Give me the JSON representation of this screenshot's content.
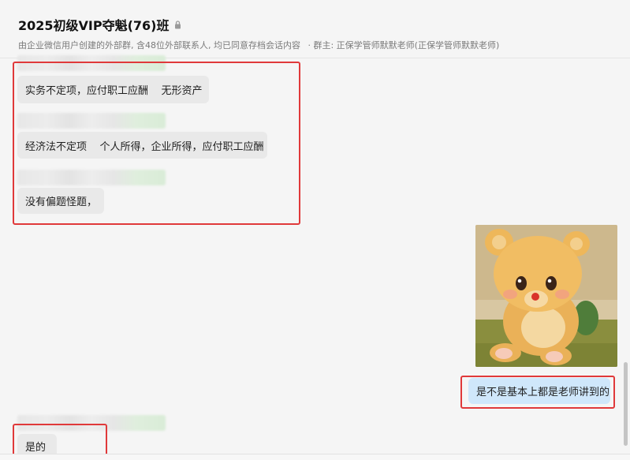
{
  "header": {
    "group_name": "2025初级VIP夺魁(76)班",
    "subtitle": "由企业微信用户创建的外部群, 含48位外部联系人, 均已同意存档会话内容",
    "owner": "· 群主: 正保学管师默默老师(正保学管师默默老师)"
  },
  "messages": [
    {
      "direction": "in",
      "text": "实务不定项，应付职工应酬    无形资产"
    },
    {
      "direction": "in",
      "text": "经济法不定项    个人所得，企业所得，应付职工应酬"
    },
    {
      "direction": "in",
      "text": "没有偏题怪题，"
    },
    {
      "direction": "out",
      "type": "sticker",
      "sticker": "teddy-bear-sticker"
    },
    {
      "direction": "out",
      "text": "是不是基本上都是老师讲到的"
    },
    {
      "direction": "in",
      "text": "是的"
    }
  ],
  "colors": {
    "background": "#f5f5f5",
    "incoming_bubble": "#e9e9e9",
    "outgoing_bubble": "#cfe7fb",
    "highlight": "#e0393a"
  }
}
